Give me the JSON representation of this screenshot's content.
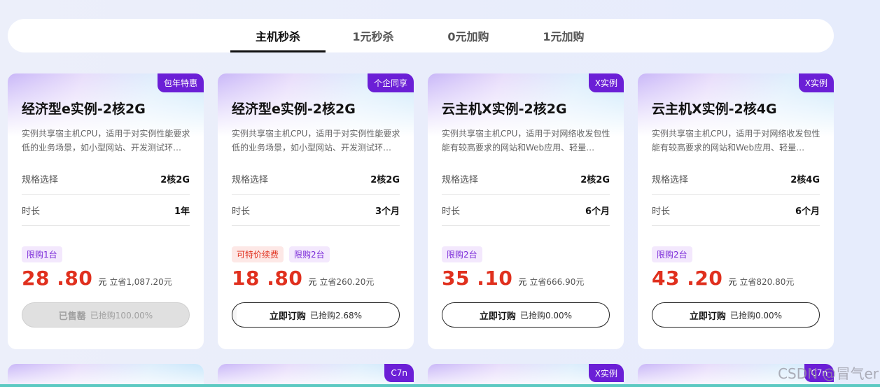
{
  "tabs": [
    {
      "label": "主机秒杀"
    },
    {
      "label": "1元秒杀"
    },
    {
      "label": "0元加购"
    },
    {
      "label": "1元加购"
    }
  ],
  "cards": [
    {
      "badge": "包年特惠",
      "title": "经济型e实例-2核2G",
      "desc": "实例共享宿主机CPU，适用于对实例性能要求低的业务场景，如小型网站、开发测试环…",
      "spec_label": "规格选择",
      "spec_value": "2核2G",
      "duration_label": "时长",
      "duration_value": "1年",
      "tags": [
        "限购1台"
      ],
      "price": "28 .80",
      "unit": "元",
      "save": "立省1,087.20元",
      "button": "已售罄",
      "sold": "已抢购100.00%",
      "sold_fraction": 1.0
    },
    {
      "badge": "个企同享",
      "title": "经济型e实例-2核2G",
      "desc": "实例共享宿主机CPU，适用于对实例性能要求低的业务场景，如小型网站、开发测试环…",
      "spec_label": "规格选择",
      "spec_value": "2核2G",
      "duration_label": "时长",
      "duration_value": "3个月",
      "tags": [
        "可特价续费",
        "限购2台"
      ],
      "price": "18 .80",
      "unit": "元",
      "save": "立省260.20元",
      "button": "立即订购",
      "sold": "已抢购2.68%",
      "sold_fraction": 0.0268
    },
    {
      "badge": "X实例",
      "title": "云主机X实例-2核2G",
      "desc": "实例共享宿主机CPU，适用于对网络收发包性能有较高要求的网站和Web应用、轻量…",
      "spec_label": "规格选择",
      "spec_value": "2核2G",
      "duration_label": "时长",
      "duration_value": "6个月",
      "tags": [
        "限购2台"
      ],
      "price": "35 .10",
      "unit": "元",
      "save": "立省666.90元",
      "button": "立即订购",
      "sold": "已抢购0.00%",
      "sold_fraction": 0.0
    },
    {
      "badge": "X实例",
      "title": "云主机X实例-2核4G",
      "desc": "实例共享宿主机CPU，适用于对网络收发包性能有较高要求的网站和Web应用、轻量…",
      "spec_label": "规格选择",
      "spec_value": "2核4G",
      "duration_label": "时长",
      "duration_value": "6个月",
      "tags": [
        "限购2台"
      ],
      "price": "43 .20",
      "unit": "元",
      "save": "立省820.80元",
      "button": "立即订购",
      "sold": "已抢购0.00%",
      "sold_fraction": 0.0
    }
  ],
  "next_row_badges": [
    "",
    "C7n",
    "X实例",
    "C7n"
  ],
  "watermark": "CSDN @冒气er",
  "colors": {
    "accent_purple": "#6b1fd6",
    "price_red": "#e0301e",
    "strip_teal": "#5cc9c2"
  }
}
